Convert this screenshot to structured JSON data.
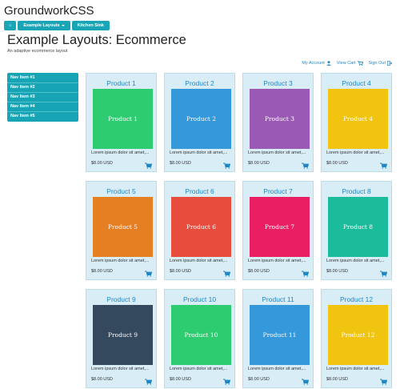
{
  "site": {
    "title": "GroundworkCSS"
  },
  "topnav": {
    "home_icon": "home-icon",
    "home_label": "⌂",
    "items": [
      {
        "label": "Example Layouts"
      },
      {
        "label": "Kitchen Sink"
      }
    ]
  },
  "page": {
    "title": "Example Layouts: Ecommerce",
    "subtitle": "An adaptive ecommerce layout"
  },
  "account": {
    "my_account": "My Account",
    "view_cart": "View Cart",
    "sign_out": "Sign Out"
  },
  "sidenav": {
    "items": [
      {
        "label": "Nav Item #1"
      },
      {
        "label": "Nav Item #2"
      },
      {
        "label": "Nav Item #3"
      },
      {
        "label": "Nav Item #4"
      },
      {
        "label": "Nav Item #5"
      }
    ]
  },
  "colors": {
    "accent": "#19a5b5",
    "link": "#1e88c6",
    "card_bg": "#d9edf7"
  },
  "products": [
    {
      "title": "Product 1",
      "image_label": "Product 1",
      "desc": "Lorem ipsum dolor sit amet,...",
      "price": "$8.00 USD",
      "color": "#2ecc71"
    },
    {
      "title": "Product 2",
      "image_label": "Product 2",
      "desc": "Lorem ipsum dolor sit amet,...",
      "price": "$8.00 USD",
      "color": "#3498db"
    },
    {
      "title": "Product 3",
      "image_label": "Product 3",
      "desc": "Lorem ipsum dolor sit amet,...",
      "price": "$8.00 USD",
      "color": "#9b59b6"
    },
    {
      "title": "Product 4",
      "image_label": "Product 4",
      "desc": "Lorem ipsum dolor sit amet,...",
      "price": "$8.00 USD",
      "color": "#f1c40f"
    },
    {
      "title": "Product 5",
      "image_label": "Product 5",
      "desc": "Lorem ipsum dolor sit amet,...",
      "price": "$8.00 USD",
      "color": "#e67e22"
    },
    {
      "title": "Product 6",
      "image_label": "Product 6",
      "desc": "Lorem ipsum dolor sit amet,...",
      "price": "$8.00 USD",
      "color": "#e74c3c"
    },
    {
      "title": "Product 7",
      "image_label": "Product 7",
      "desc": "Lorem ipsum dolor sit amet,...",
      "price": "$8.00 USD",
      "color": "#e91e63"
    },
    {
      "title": "Product 8",
      "image_label": "Product 8",
      "desc": "Lorem ipsum dolor sit amet,...",
      "price": "$8.00 USD",
      "color": "#1abc9c"
    },
    {
      "title": "Product 9",
      "image_label": "Product 9",
      "desc": "Lorem ipsum dolor sit amet,...",
      "price": "$8.00 USD",
      "color": "#34495e"
    },
    {
      "title": "Product 10",
      "image_label": "Product 10",
      "desc": "Lorem ipsum dolor sit amet,...",
      "price": "$8.00 USD",
      "color": "#2ecc71"
    },
    {
      "title": "Product 11",
      "image_label": "Product 11",
      "desc": "Lorem ipsum dolor sit amet,...",
      "price": "$8.00 USD",
      "color": "#3498db"
    },
    {
      "title": "Product 12",
      "image_label": "Product 12",
      "desc": "Lorem ipsum dolor sit amet,...",
      "price": "$8.00 USD",
      "color": "#f1c40f"
    }
  ]
}
